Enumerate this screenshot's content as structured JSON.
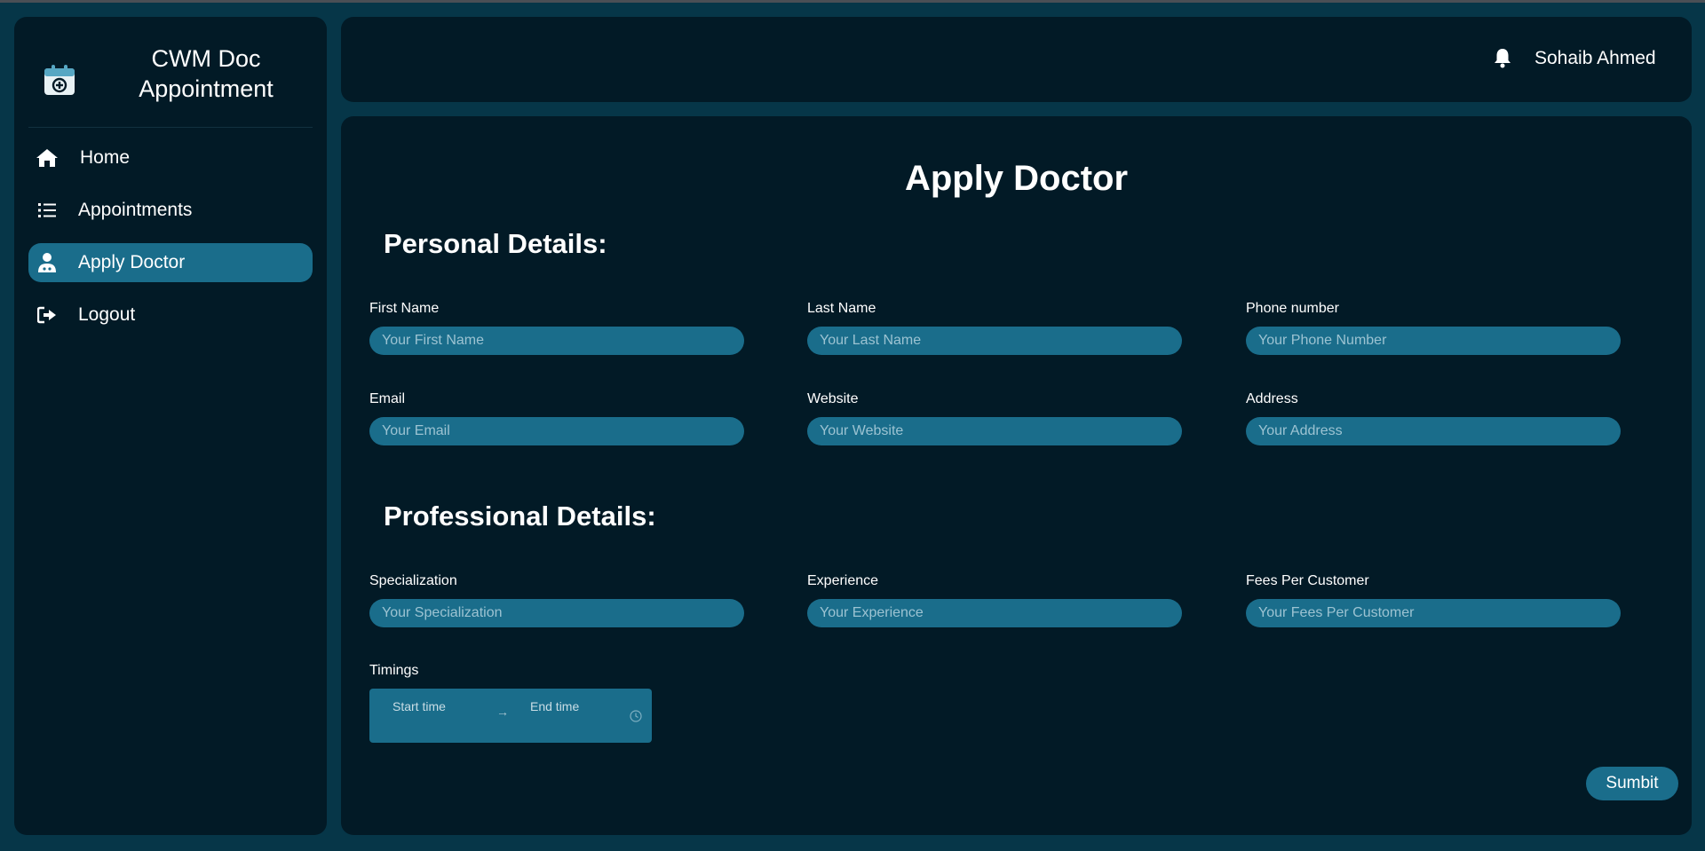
{
  "app": {
    "brand_title": "CWM Doc\nAppointment"
  },
  "sidebar": {
    "items": [
      {
        "label": "Home",
        "icon": "home-icon",
        "active": false
      },
      {
        "label": "Appointments",
        "icon": "list-icon",
        "active": false
      },
      {
        "label": "Apply Doctor",
        "icon": "user-doctor-icon",
        "active": true
      },
      {
        "label": "Logout",
        "icon": "logout-icon",
        "active": false
      }
    ]
  },
  "header": {
    "username": "Sohaib Ahmed",
    "notification_icon": "bell-icon"
  },
  "main": {
    "title": "Apply Doctor",
    "personal_title": "Personal Details:",
    "professional_title": "Professional Details:",
    "fields": {
      "first_name": {
        "label": "First Name",
        "placeholder": "Your First Name"
      },
      "last_name": {
        "label": "Last Name",
        "placeholder": "Your Last Name"
      },
      "phone": {
        "label": "Phone number",
        "placeholder": "Your Phone Number"
      },
      "email": {
        "label": "Email",
        "placeholder": "Your Email"
      },
      "website": {
        "label": "Website",
        "placeholder": "Your Website"
      },
      "address": {
        "label": "Address",
        "placeholder": "Your Address"
      },
      "specialization": {
        "label": "Specialization",
        "placeholder": "Your Specialization"
      },
      "experience": {
        "label": "Experience",
        "placeholder": "Your Experience"
      },
      "fees": {
        "label": "Fees Per Customer",
        "placeholder": "Your Fees Per Customer"
      }
    },
    "timings": {
      "label": "Timings",
      "start_placeholder": "Start time",
      "arrow": "→",
      "end_placeholder": "End time"
    },
    "submit_label": "Sumbit"
  },
  "colors": {
    "background": "#063648",
    "panel": "#021a26",
    "accent": "#1a6d8b",
    "placeholder": "#9cc3d2"
  }
}
